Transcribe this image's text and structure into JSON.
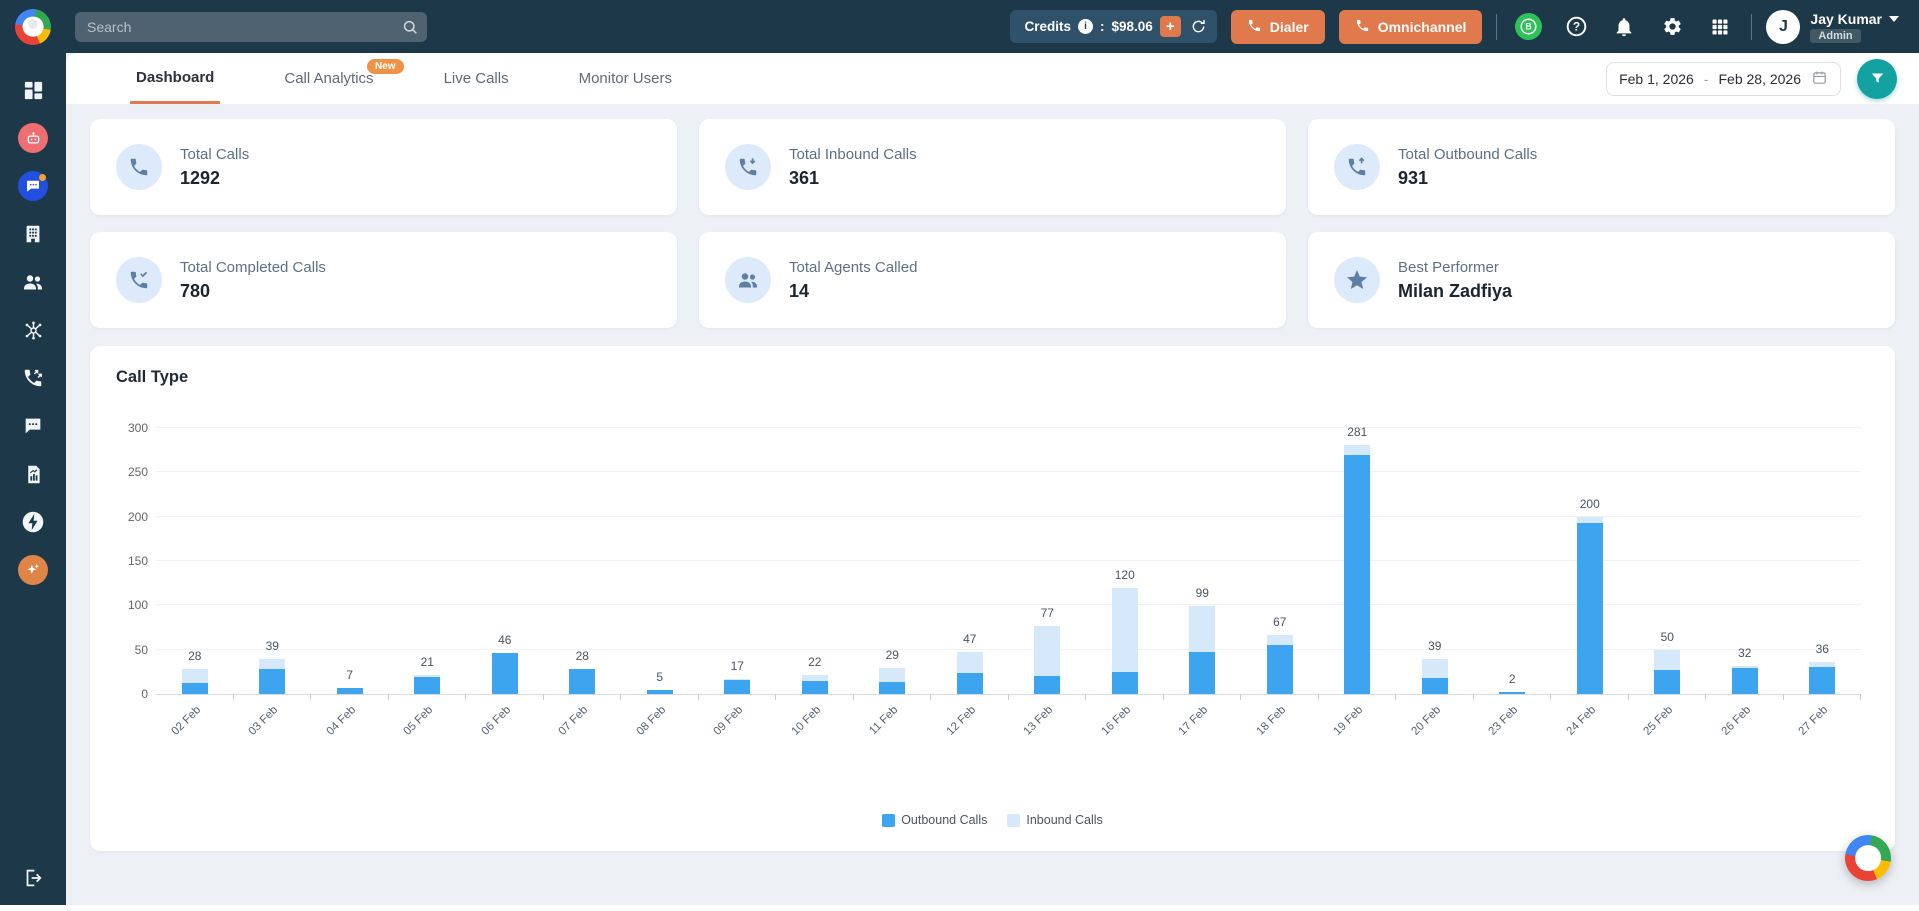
{
  "topbar": {
    "search": {
      "placeholder": "Search"
    },
    "credits": {
      "label": "Credits",
      "separator": ":",
      "value": "$98.06"
    },
    "buttons": {
      "dialer": "Dialer",
      "omnichannel": "Omnichannel"
    },
    "icons": [
      "whatsapp-business-icon",
      "help-icon",
      "notifications-icon",
      "settings-icon",
      "apps-grid-icon"
    ],
    "user": {
      "name": "Jay Kumar",
      "role": "Admin",
      "initial": "J"
    }
  },
  "sidebar": {
    "icons": [
      "dashboard-icon",
      "bot-icon",
      "chat-icon",
      "company-icon",
      "contacts-icon",
      "hub-icon",
      "call-forward-icon",
      "sms-icon",
      "report-icon",
      "power-icon",
      "ai-icon",
      "exit-icon"
    ]
  },
  "tabs": [
    {
      "label": "Dashboard",
      "active": true
    },
    {
      "label": "Call Analytics",
      "active": false,
      "badge": "New"
    },
    {
      "label": "Live Calls",
      "active": false
    },
    {
      "label": "Monitor Users",
      "active": false
    }
  ],
  "date_range": {
    "start": "Feb 1, 2026",
    "separator": "-",
    "end": "Feb 28, 2026"
  },
  "stats": [
    {
      "label": "Total Calls",
      "value": "1292",
      "icon": "phone-icon"
    },
    {
      "label": "Total Inbound Calls",
      "value": "361",
      "icon": "phone-incoming-icon"
    },
    {
      "label": "Total Outbound Calls",
      "value": "931",
      "icon": "phone-outgoing-icon"
    },
    {
      "label": "Total Completed Calls",
      "value": "780",
      "icon": "phone-completed-icon"
    },
    {
      "label": "Total Agents Called",
      "value": "14",
      "icon": "agents-icon"
    },
    {
      "label": "Best Performer",
      "value": "Milan Zadfiya",
      "icon": "star-icon"
    }
  ],
  "chart_title": "Call Type",
  "chart_data": {
    "type": "bar",
    "stacked": true,
    "title": "Call Type",
    "categories": [
      "02 Feb",
      "03 Feb",
      "04 Feb",
      "05 Feb",
      "06 Feb",
      "07 Feb",
      "08 Feb",
      "09 Feb",
      "10 Feb",
      "11 Feb",
      "12 Feb",
      "13 Feb",
      "16 Feb",
      "17 Feb",
      "18 Feb",
      "19 Feb",
      "20 Feb",
      "23 Feb",
      "24 Feb",
      "25 Feb",
      "26 Feb",
      "27 Feb"
    ],
    "series": [
      {
        "name": "Outbound Calls",
        "color": "#3da4ef",
        "values": [
          12,
          28,
          7,
          19,
          46,
          28,
          5,
          16,
          15,
          14,
          24,
          20,
          25,
          47,
          55,
          270,
          18,
          2,
          193,
          27,
          29,
          31
        ]
      },
      {
        "name": "Inbound Calls",
        "color": "#d6e9fa",
        "values": [
          16,
          11,
          0,
          2,
          0,
          0,
          0,
          1,
          7,
          15,
          23,
          57,
          95,
          52,
          12,
          11,
          21,
          0,
          7,
          23,
          3,
          5
        ]
      }
    ],
    "totals": [
      28,
      39,
      7,
      21,
      46,
      28,
      5,
      17,
      22,
      29,
      47,
      77,
      120,
      99,
      67,
      281,
      39,
      2,
      200,
      50,
      32,
      36
    ],
    "xlabel": "",
    "ylabel": "",
    "ylim": [
      0,
      300
    ],
    "yticks": [
      0,
      50,
      100,
      150,
      200,
      250,
      300
    ],
    "grid": true,
    "legend_position": "bottom"
  },
  "colors": {
    "topbar_navy": "#1d3848",
    "orange": "#e0794b",
    "badge_orange": "#ef9245",
    "teal": "#14a2a0",
    "whatsapp_green": "#2dc258",
    "outbound_bar": "#3da4ef",
    "inbound_bar": "#d6e9fa",
    "stat_icon_bg": "#ddeafb",
    "page_bg": "#edf1f6"
  }
}
